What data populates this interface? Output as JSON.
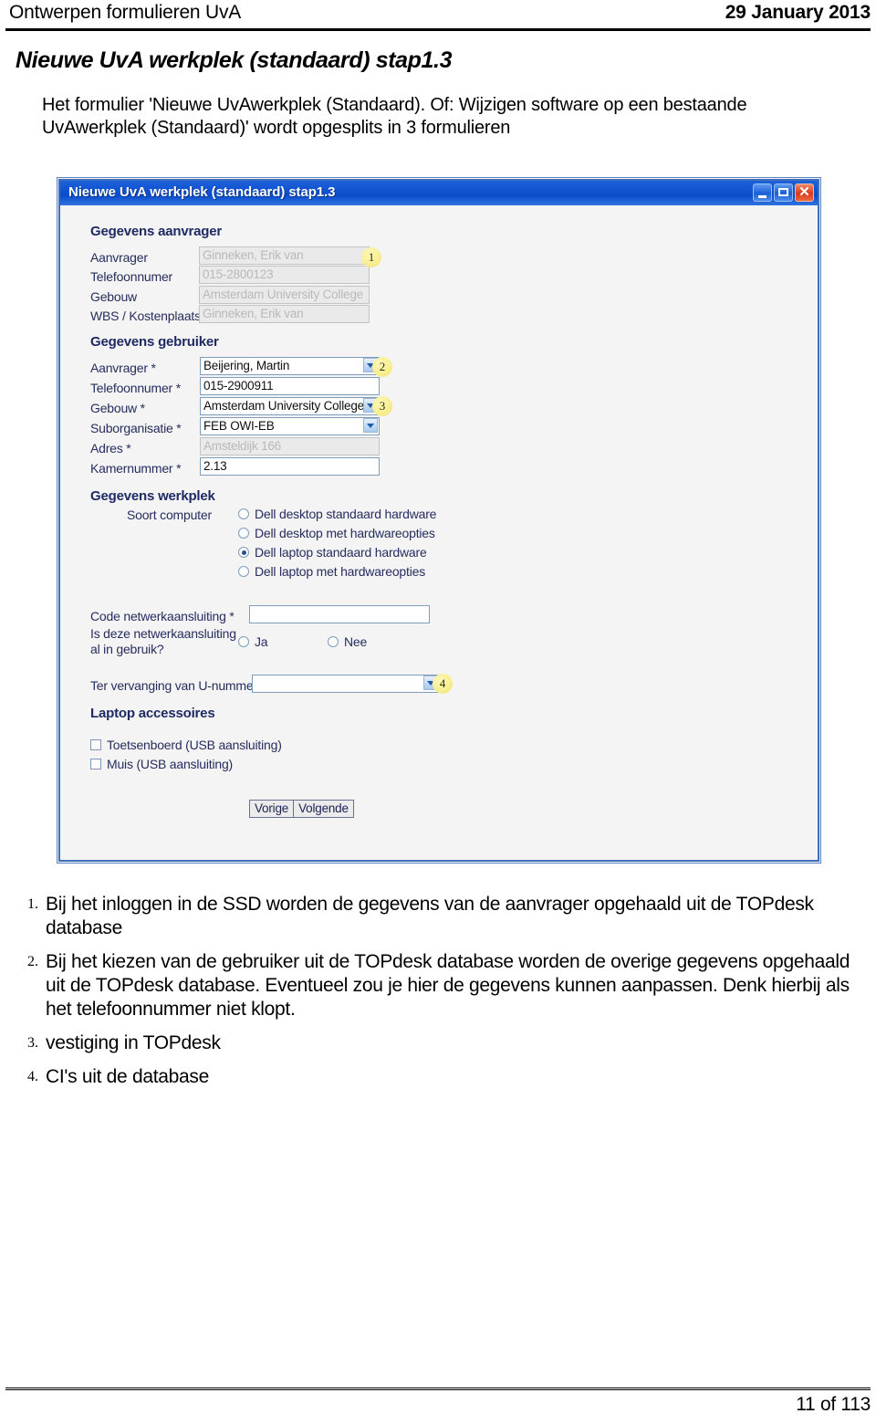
{
  "page_header": {
    "left_text": "Ontwerpen formulieren UvA",
    "right_text": "29 January 2013"
  },
  "document": {
    "title": "Nieuwe UvA werkplek (standaard) stap1.3",
    "intro": "Het formulier 'Nieuwe UvAwerkplek (Standaard). Of: Wijzigen software op een bestaande UvAwerkplek (Standaard)' wordt opgesplits in 3 formulieren"
  },
  "window": {
    "title": "Nieuwe UvA werkplek (standaard) stap1.3",
    "controls": {
      "minimize": "minimize",
      "maximize": "maximize",
      "close": "close"
    },
    "sections": {
      "aanvrager": {
        "heading": "Gegevens aanvrager",
        "fields": [
          {
            "label": "Aanvrager",
            "value": "Ginneken, Erik van",
            "state": "disabled"
          },
          {
            "label": "Telefoonnumer",
            "value": "015-2800123",
            "state": "disabled"
          },
          {
            "label": "Gebouw",
            "value": "Amsterdam University College",
            "state": "disabled"
          },
          {
            "label": "WBS / Kostenplaats",
            "value": "Ginneken, Erik van",
            "state": "disabled"
          }
        ]
      },
      "gebruiker": {
        "heading": "Gegevens gebruiker",
        "fields": [
          {
            "label": "Aanvrager *",
            "value": "Beijering, Martin",
            "state": "select"
          },
          {
            "label": "Telefoonnumer *",
            "value": "015-2900911",
            "state": "text"
          },
          {
            "label": "Gebouw *",
            "value": "Amsterdam University College",
            "state": "select"
          },
          {
            "label": "Suborganisatie *",
            "value": "FEB OWI-EB",
            "state": "select"
          },
          {
            "label": "Adres *",
            "value": "Amsteldijk 166",
            "state": "disabled"
          },
          {
            "label": "Kamernummer *",
            "value": "2.13",
            "state": "text"
          }
        ]
      },
      "werkplek": {
        "heading": "Gegevens werkplek",
        "soort_computer_label": "Soort computer",
        "soort_computer_options": [
          {
            "label": "Dell desktop standaard hardware",
            "selected": false
          },
          {
            "label": "Dell desktop met hardwareopties",
            "selected": false
          },
          {
            "label": "Dell laptop standaard hardware",
            "selected": true
          },
          {
            "label": "Dell laptop met hardwareopties",
            "selected": false
          }
        ],
        "code_netwerk_label": "Code netwerkaansluiting *",
        "code_netwerk_value": "",
        "in_gebruik_label": "Is deze netwerkaansluiting al in gebruik?",
        "in_gebruik_options": [
          {
            "label": "Ja",
            "selected": false
          },
          {
            "label": "Nee",
            "selected": false
          }
        ],
        "vervanging_label": "Ter vervanging van U-nummer",
        "vervanging_value": ""
      },
      "accessoires": {
        "heading": "Laptop accessoires",
        "items": [
          {
            "label": "Toetsenboerd (USB aansluiting)",
            "checked": false
          },
          {
            "label": "Muis (USB aansluiting)",
            "checked": false
          }
        ]
      }
    },
    "buttons": {
      "prev": "Vorige",
      "next": "Volgende"
    },
    "callouts": [
      {
        "number": "1"
      },
      {
        "number": "2"
      },
      {
        "number": "3"
      },
      {
        "number": "4"
      }
    ]
  },
  "notes": [
    {
      "num": "1.",
      "text": "Bij het inloggen in de SSD worden de gegevens van de aanvrager opgehaald uit de TOPdesk database"
    },
    {
      "num": "2.",
      "text": "Bij het kiezen van de gebruiker uit de TOPdesk database worden de overige gegevens opgehaald uit de TOPdesk database. Eventueel zou je hier de gegevens kunnen aanpassen. Denk hierbij als het telefoonnummer niet klopt."
    },
    {
      "num": "3.",
      "text": "vestiging in TOPdesk"
    },
    {
      "num": "4.",
      "text": "CI's uit de database"
    }
  ],
  "footer": {
    "page": "11 of 113"
  }
}
